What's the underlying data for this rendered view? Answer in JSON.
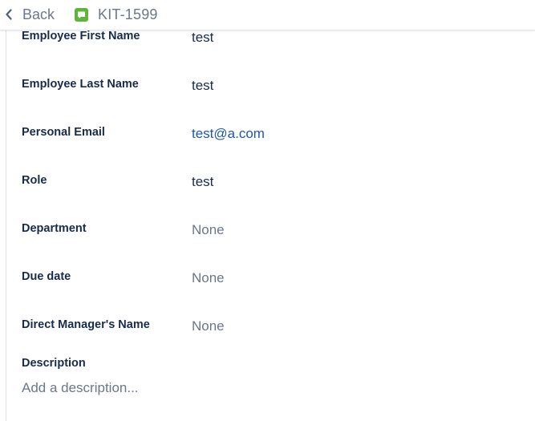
{
  "header": {
    "back_label": "Back",
    "issue_key": "KIT-1599",
    "back_icon": "chevron-left-icon",
    "issue_type_icon": "story-icon"
  },
  "fields": [
    {
      "label": "Employee First Name",
      "value": "test",
      "kind": "text"
    },
    {
      "label": "Employee Last Name",
      "value": "test",
      "kind": "text"
    },
    {
      "label": "Personal Email",
      "value": "test@a.com",
      "kind": "link"
    },
    {
      "label": "Role",
      "value": "test",
      "kind": "text"
    },
    {
      "label": "Department",
      "value": "None",
      "kind": "empty"
    },
    {
      "label": "Due date",
      "value": "None",
      "kind": "empty"
    },
    {
      "label": "Direct Manager's Name",
      "value": "None",
      "kind": "empty"
    }
  ],
  "description": {
    "label": "Description",
    "placeholder": "Add a description..."
  },
  "colors": {
    "text": "#172b4d",
    "muted": "#6b778c",
    "link": "#1d55b8",
    "story_icon": "#5fb43a"
  }
}
